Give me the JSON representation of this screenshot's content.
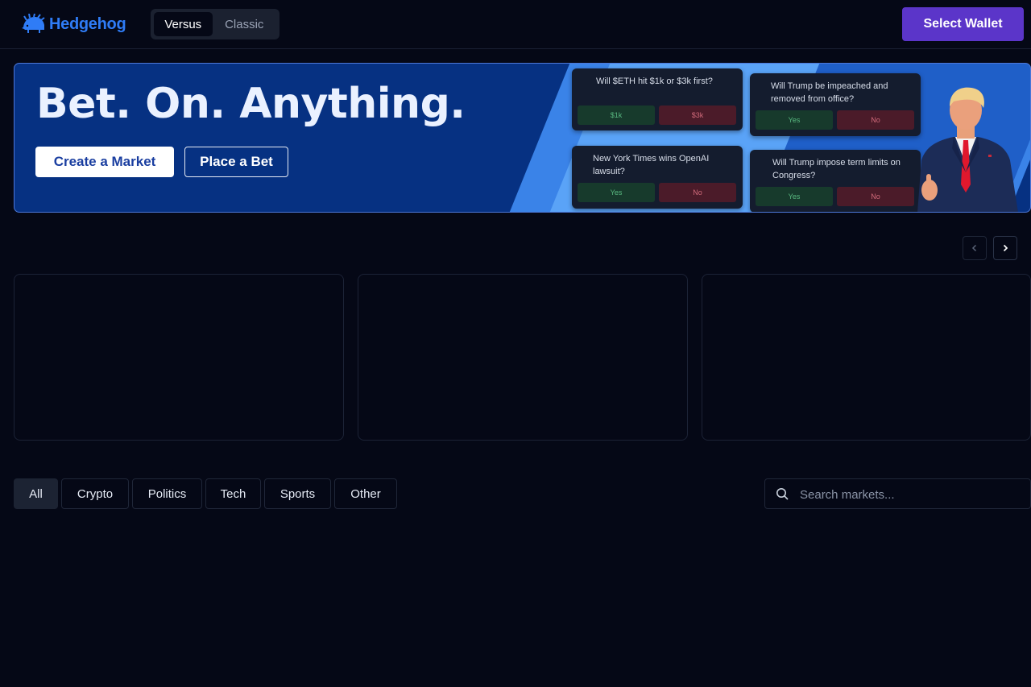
{
  "header": {
    "brand": "Hedgehog",
    "brand_color": "#2f7cf6",
    "modes": [
      {
        "label": "Versus",
        "active": true
      },
      {
        "label": "Classic",
        "active": false
      }
    ],
    "wallet_label": "Select Wallet",
    "wallet_color": "#5b35c9"
  },
  "hero": {
    "title": "Bet. On. Anything.",
    "create_label": "Create a Market",
    "bet_label": "Place a Bet",
    "cards": [
      {
        "question": "Will $ETH hit $1k or $3k first?",
        "option_a": "$1k",
        "option_b": "$3k"
      },
      {
        "question": "Will Trump be impeached and removed from office?",
        "option_a": "Yes",
        "option_b": "No"
      },
      {
        "question": "New York Times wins OpenAI lawsuit?",
        "option_a": "Yes",
        "option_b": "No"
      },
      {
        "question": "Will Trump impose term limits on Congress?",
        "option_a": "Yes",
        "option_b": "No"
      }
    ]
  },
  "carousel": {
    "prev_icon": "chevron-left-icon",
    "next_icon": "chevron-right-icon"
  },
  "filters": {
    "categories": [
      "All",
      "Crypto",
      "Politics",
      "Tech",
      "Sports",
      "Other"
    ],
    "active": "All"
  },
  "search": {
    "placeholder": "Search markets...",
    "value": ""
  }
}
